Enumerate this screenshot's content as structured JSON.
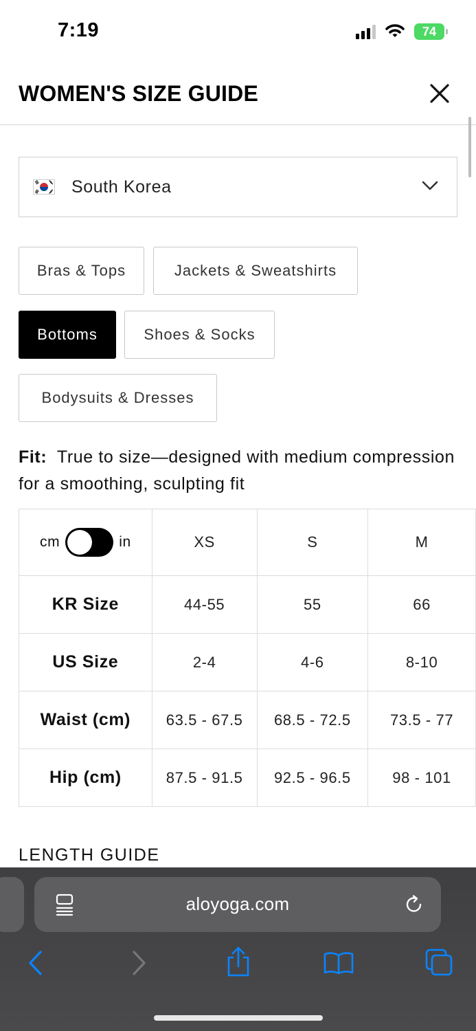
{
  "status_bar": {
    "time": "7:19",
    "battery": "74"
  },
  "header": {
    "title": "WOMEN'S SIZE GUIDE",
    "close_icon": "close-icon"
  },
  "country_select": {
    "value": "South Korea",
    "flag_icon": "south-korea-flag-icon",
    "chevron_icon": "chevron-down-icon"
  },
  "categories": [
    {
      "label": "Bras & Tops",
      "active": false
    },
    {
      "label": "Jackets & Sweatshirts",
      "active": false
    },
    {
      "label": "Bottoms",
      "active": true
    },
    {
      "label": "Shoes & Socks",
      "active": false
    },
    {
      "label": "Bodysuits & Dresses",
      "active": false
    }
  ],
  "fit": {
    "label": "Fit:",
    "text": "True to size—designed with medium compression for a smoothing, sculpting fit"
  },
  "unit_toggle": {
    "left": "cm",
    "right": "in",
    "selected": "cm"
  },
  "size_table": {
    "columns": [
      "XS",
      "S",
      "M"
    ],
    "rows": [
      {
        "label": "KR Size",
        "values": [
          "44-55",
          "55",
          "66"
        ]
      },
      {
        "label": "US Size",
        "values": [
          "2-4",
          "4-6",
          "8-10"
        ]
      },
      {
        "label": "Waist (cm)",
        "values": [
          "63.5 - 67.5",
          "68.5 - 72.5",
          "73.5 - 77"
        ]
      },
      {
        "label": "Hip (cm)",
        "values": [
          "87.5 - 91.5",
          "92.5 - 96.5",
          "98 - 101"
        ]
      }
    ]
  },
  "length_guide": {
    "heading": "LENGTH GUIDE"
  },
  "browser": {
    "url": "aloyoga.com",
    "icons": [
      "reader-icon",
      "reload-icon",
      "back-icon",
      "forward-icon",
      "share-icon",
      "bookmarks-icon",
      "tabs-icon"
    ]
  },
  "colors": {
    "active_chip": "#000000",
    "battery": "#4cd964",
    "accent": "#0a84ff"
  }
}
